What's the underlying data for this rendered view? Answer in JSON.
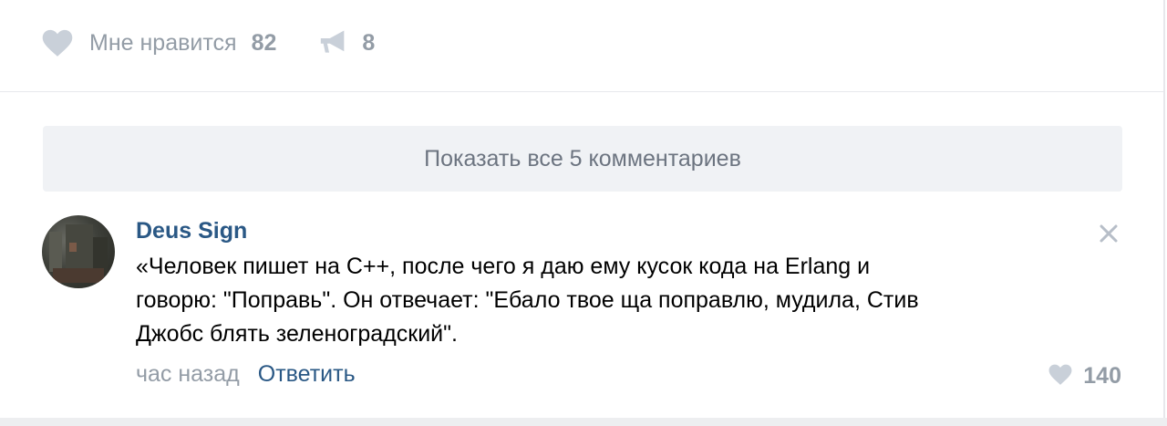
{
  "post": {
    "like_label": "Мне нравится",
    "like_count": "82",
    "share_count": "8"
  },
  "comments_block": {
    "show_all_label": "Показать все 5 комментариев"
  },
  "comment": {
    "author": "Deus Sign",
    "text": "«Человек пишет на C++, после чего я даю ему кусок кода на Erlang и\nговорю: \"Поправь\". Он отвечает: \"Ебало твое ща поправлю, мудила, Стив\nДжобс блять зеленоградский\".",
    "time": "час назад",
    "reply_label": "Ответить",
    "like_count": "140"
  },
  "icons": {
    "like": "heart-icon",
    "share": "megaphone-icon",
    "close": "close-icon",
    "comment_like": "heart-icon"
  },
  "colors": {
    "link": "#2a5885",
    "muted": "#939ca6",
    "button_bg": "#f0f2f5",
    "icon": "#c5ccd6"
  }
}
